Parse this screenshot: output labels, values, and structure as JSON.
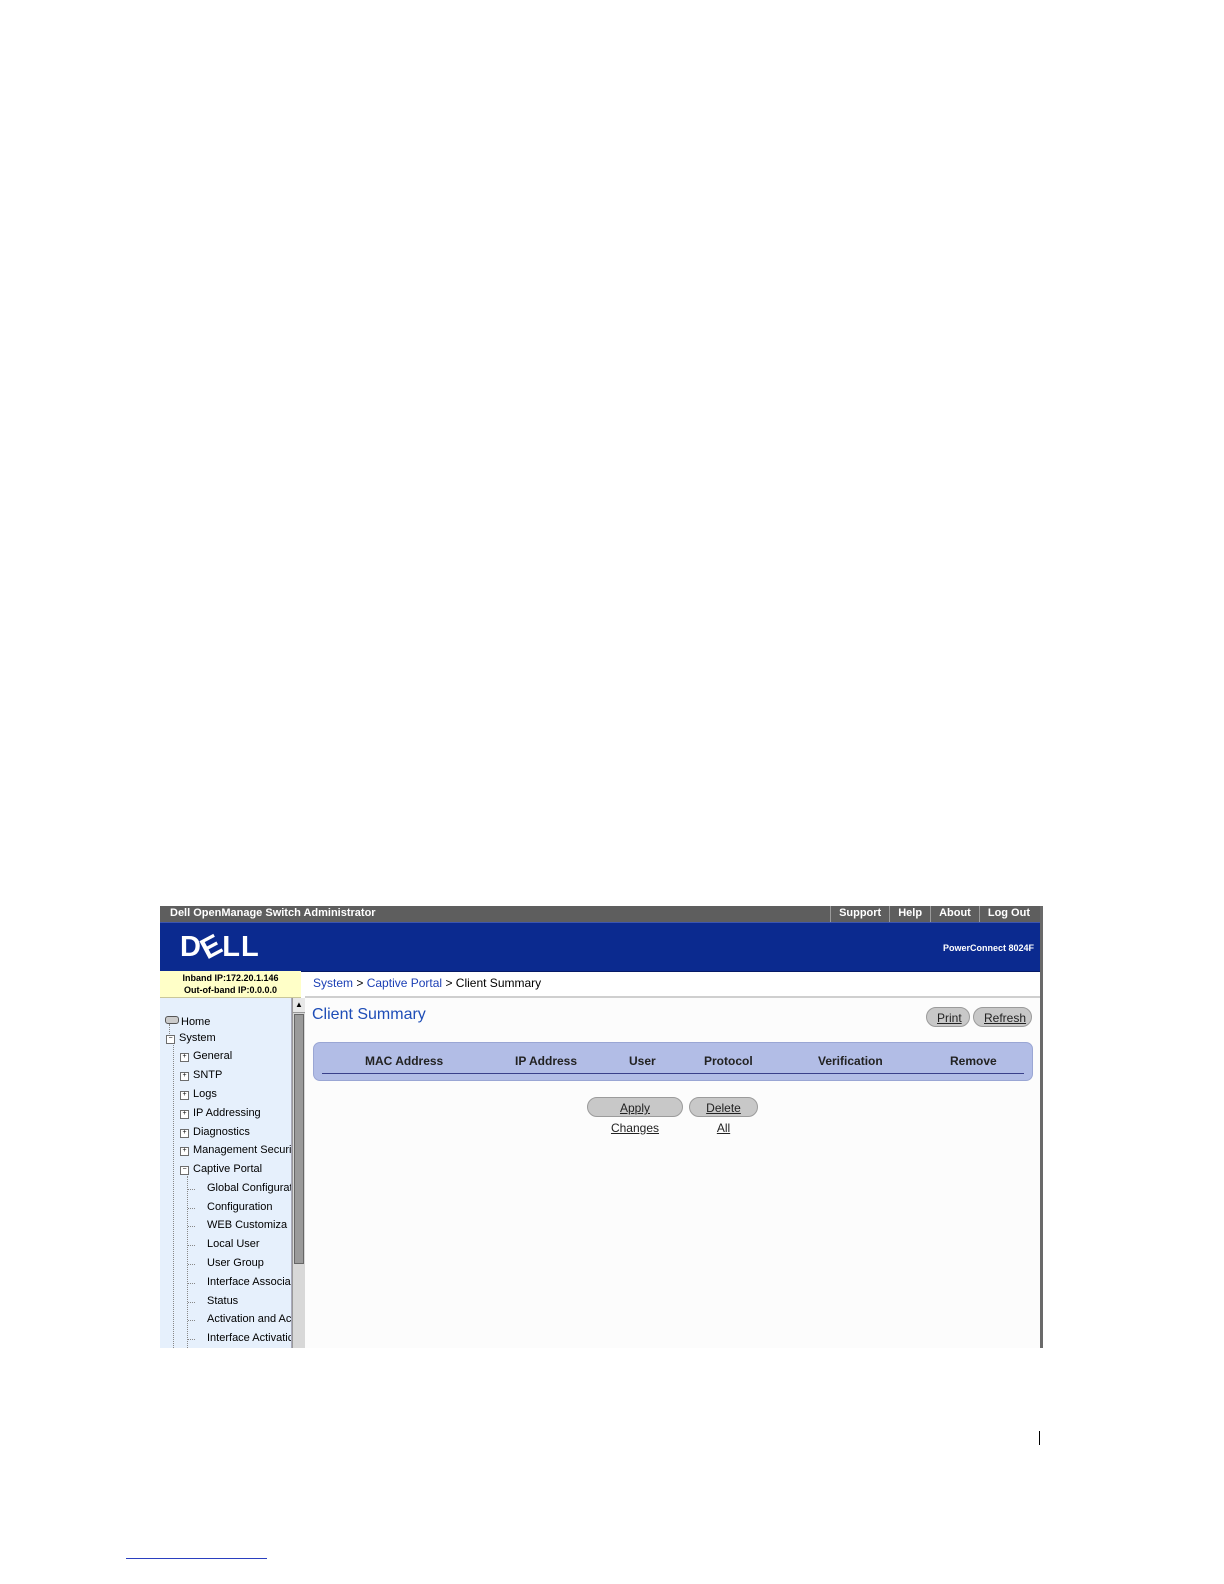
{
  "window": {
    "title": "Dell OpenManage Switch Administrator"
  },
  "topnav": [
    "Support",
    "Help",
    "About",
    "Log Out"
  ],
  "header": {
    "logo": "DELL",
    "model": "PowerConnect 8024F"
  },
  "ipinfo": {
    "inband": "Inband IP:172.20.1.146",
    "outofband": "Out-of-band IP:0.0.0.0"
  },
  "sidebar": {
    "home": "Home",
    "system": "System",
    "items": [
      "General",
      "SNTP",
      "Logs",
      "IP Addressing",
      "Diagnostics",
      "Management Securi",
      "Captive Portal"
    ],
    "captive_children": [
      "Global Configurat",
      "Configuration",
      "WEB Customiza",
      "Local User",
      "User Group",
      "Interface Associa",
      "Status",
      "Activation and Ac",
      "Interface Activatic"
    ]
  },
  "breadcrumb": {
    "system": "System",
    "sep1": ">",
    "captive": "Captive Portal",
    "sep2": ">",
    "current": "Client Summary"
  },
  "page": {
    "title": "Client Summary",
    "print": "Print",
    "refresh": "Refresh",
    "apply": "Apply Changes",
    "delete_all": "Delete All"
  },
  "table": {
    "columns": [
      "MAC Address",
      "IP Address",
      "User",
      "Protocol",
      "Verification",
      "Remove"
    ]
  }
}
